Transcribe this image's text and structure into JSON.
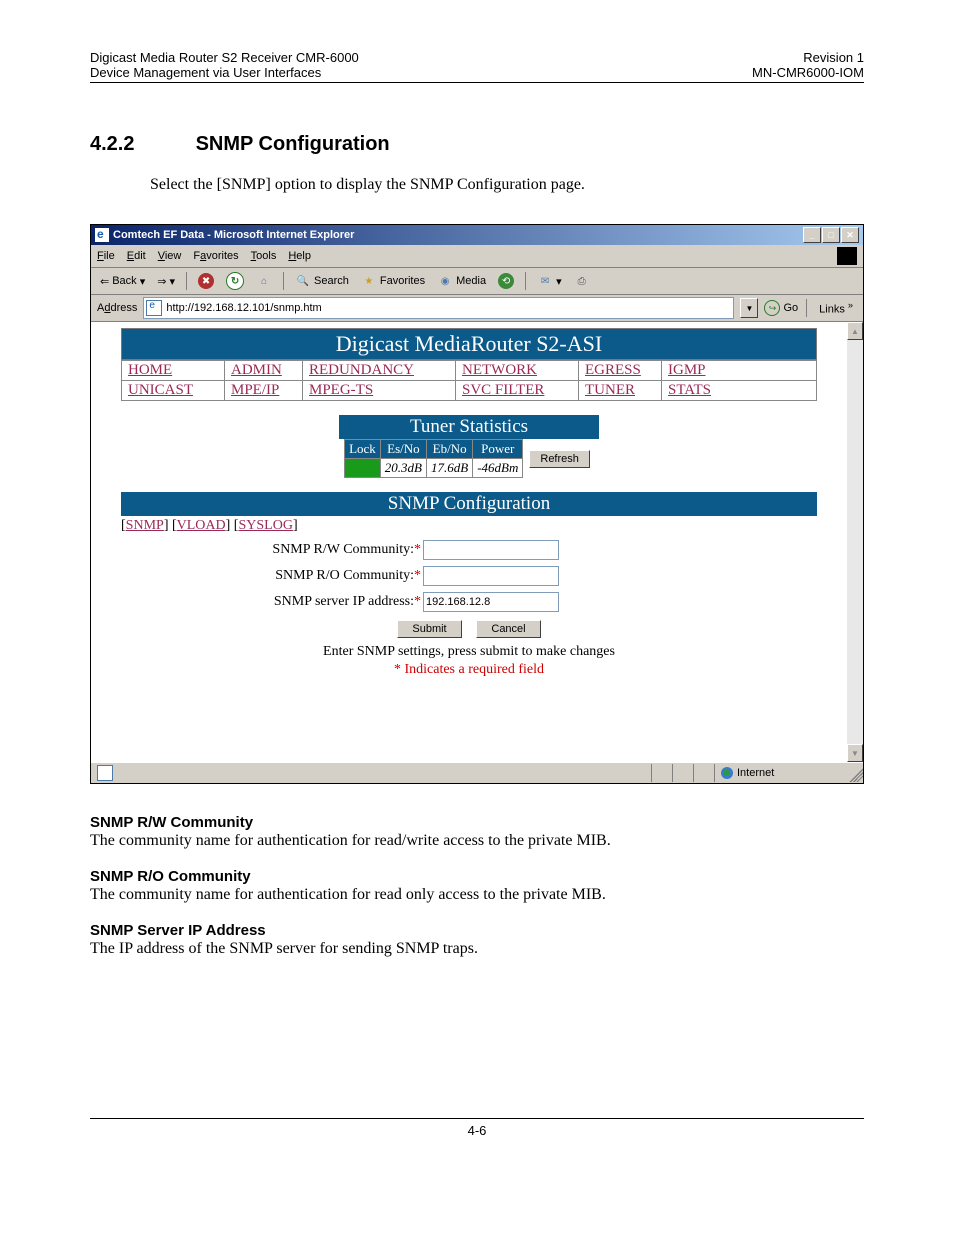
{
  "doc": {
    "header_left_1": "Digicast Media Router S2 Receiver CMR-6000",
    "header_left_2": "Device Management via User Interfaces",
    "header_right_1": "Revision 1",
    "header_right_2": "MN-CMR6000-IOM",
    "section_num": "4.2.2",
    "section_title": "SNMP Configuration",
    "intro": "Select the [SNMP] option to display the SNMP Configuration page.",
    "footer": "4-6"
  },
  "ie": {
    "title": "Comtech EF Data - Microsoft Internet Explorer",
    "menus": {
      "file": "File",
      "edit": "Edit",
      "view": "View",
      "favorites": "Favorites",
      "tools": "Tools",
      "help": "Help"
    },
    "toolbar": {
      "back": "Back",
      "search": "Search",
      "favorites": "Favorites",
      "media": "Media"
    },
    "address_label": "Address",
    "url": "http://192.168.12.101/snmp.htm",
    "go": "Go",
    "links": "Links",
    "status_zone": "Internet"
  },
  "page": {
    "banner": "Digicast MediaRouter S2-ASI",
    "nav_row1": {
      "home": "HOME",
      "admin": "ADMIN",
      "redundancy": "REDUNDANCY",
      "network": "NETWORK",
      "egress": "EGRESS",
      "igmp": "IGMP"
    },
    "nav_row2": {
      "unicast": "UNICAST",
      "mpeip": "MPE/IP",
      "mpegts": "MPEG-TS",
      "svcfilter": "SVC FILTER",
      "tuner": "TUNER",
      "stats": "STATS"
    },
    "tuner": {
      "title": "Tuner Statistics",
      "h_lock": "Lock",
      "h_esno": "Es/No",
      "h_ebno": "Eb/No",
      "h_power": "Power",
      "esno": "20.3dB",
      "ebno": "17.6dB",
      "power": "-46dBm",
      "refresh": "Refresh"
    },
    "snmp": {
      "title": "SNMP Configuration",
      "link_snmp": "SNMP",
      "link_vload": "VLOAD",
      "link_syslog": "SYSLOG",
      "label_rw": "SNMP R/W Community:",
      "label_ro": "SNMP R/O Community:",
      "label_ip": "SNMP server IP address:",
      "ip_value": "192.168.12.8",
      "submit": "Submit",
      "cancel": "Cancel",
      "help": "Enter SNMP settings, press submit to make changes",
      "req_note": "* Indicates a required field"
    }
  },
  "desc": {
    "rw_title": "SNMP R/W Community",
    "rw_text": "The community name for authentication for read/write access to the private MIB.",
    "ro_title": "SNMP R/O Community",
    "ro_text": "The community name for authentication for read only access to the private MIB.",
    "ip_title": "SNMP Server IP Address",
    "ip_text": "The IP address of the SNMP server for sending SNMP traps."
  }
}
